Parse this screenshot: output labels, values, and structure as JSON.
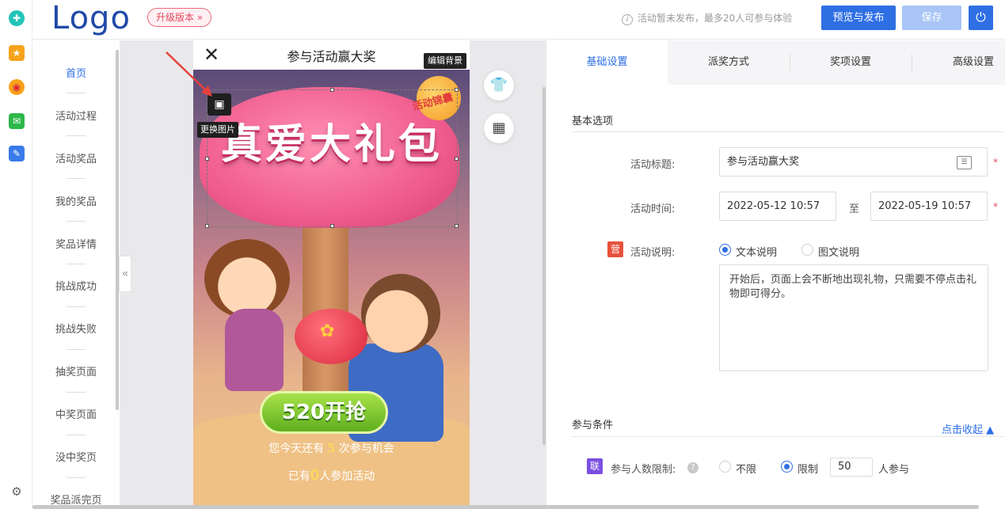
{
  "brand": {
    "logo": "Logo",
    "upgrade_label": "升级版本 »"
  },
  "header": {
    "notice": "活动暂未发布，最多20人可参与体验",
    "preview_label": "预览与发布",
    "save_label": "保存",
    "accent": "#2f6fe4"
  },
  "rail_icons": [
    "plus-icon",
    "star-icon",
    "weibo-icon",
    "mail-icon",
    "document-icon",
    "settings-icon"
  ],
  "pagenav": {
    "items": [
      {
        "label": "首页",
        "active": true
      },
      {
        "label": "活动过程"
      },
      {
        "label": "活动奖品"
      },
      {
        "label": "我的奖品"
      },
      {
        "label": "奖品详情"
      },
      {
        "label": "挑战成功"
      },
      {
        "label": "挑战失败"
      },
      {
        "label": "抽奖页面"
      },
      {
        "label": "中奖页面"
      },
      {
        "label": "没中奖页"
      },
      {
        "label": "奖品派完页"
      }
    ],
    "collapse_glyph": "«"
  },
  "phone": {
    "title": "参与活动赢大奖",
    "close_glyph": "✕",
    "edit_bg_label": "编辑背景",
    "swap_tooltip": "更换图片",
    "poster_title": "真爱大礼包",
    "bag_text": "活动锦囊",
    "start_button": "520开抢",
    "remain_prefix": "您今天还有",
    "remain_count": "5",
    "remain_suffix": "次参与机会",
    "joined_prefix": "已有",
    "joined_count": "0",
    "joined_suffix": "人参加活动"
  },
  "tools": {
    "skin_icon": "shirt-icon",
    "layout_icon": "grid-icon"
  },
  "tabs": [
    {
      "label": "基础设置",
      "active": true
    },
    {
      "label": "派奖方式"
    },
    {
      "label": "奖项设置"
    },
    {
      "label": "高级设置"
    }
  ],
  "basic": {
    "section_title": "基本选项",
    "title_label": "活动标题:",
    "title_value": "参与活动赢大奖",
    "time_label": "活动时间:",
    "time_start": "2022-05-12 10:57",
    "time_sep": "至",
    "time_end": "2022-05-19 10:57",
    "desc_badge": "营",
    "desc_label": "活动说明:",
    "desc_opt_text": "文本说明",
    "desc_opt_image": "图文说明",
    "desc_value": "开始后，页面上会不断地出现礼物，只需要不停点击礼物即可得分。"
  },
  "conditions": {
    "section_title": "参与条件",
    "collapse_label": "点击收起 ▲",
    "limit_badge": "联",
    "limit_label": "参与人数限制:",
    "opt_unlimited": "不限",
    "opt_limited": "限制",
    "limit_value": "50",
    "limit_unit": "人参与"
  }
}
